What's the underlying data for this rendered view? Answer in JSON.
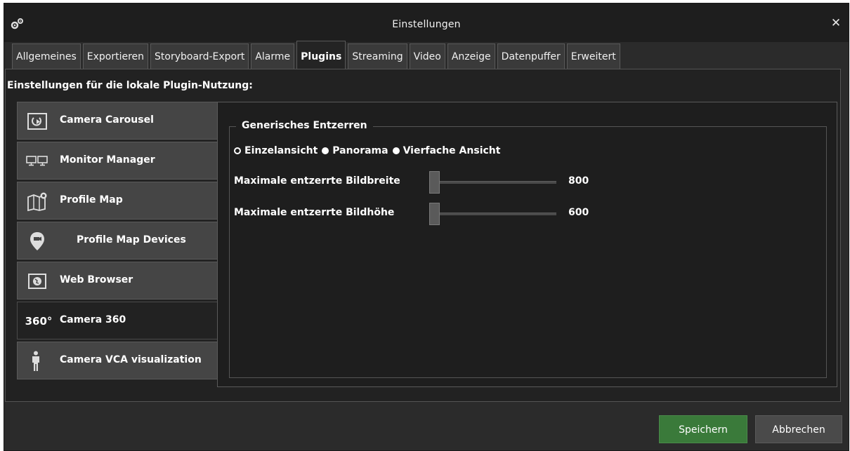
{
  "window": {
    "title": "Einstellungen",
    "close_glyph": "✕"
  },
  "tabs": [
    {
      "label": "Allgemeines",
      "active": false
    },
    {
      "label": "Exportieren",
      "active": false
    },
    {
      "label": "Storyboard-Export",
      "active": false
    },
    {
      "label": "Alarme",
      "active": false
    },
    {
      "label": "Plugins",
      "active": true
    },
    {
      "label": "Streaming",
      "active": false
    },
    {
      "label": "Video",
      "active": false
    },
    {
      "label": "Anzeige",
      "active": false
    },
    {
      "label": "Datenpuffer",
      "active": false
    },
    {
      "label": "Erweitert",
      "active": false
    }
  ],
  "plugins_section": {
    "header": "Einstellungen für die lokale Plugin-Nutzung:",
    "items": [
      {
        "label": "Camera Carousel",
        "icon": "camera-carousel-icon",
        "active": false
      },
      {
        "label": "Monitor Manager",
        "icon": "monitor-manager-icon",
        "active": false
      },
      {
        "label": "Profile Map",
        "icon": "profile-map-icon",
        "active": false
      },
      {
        "label": "Profile Map Devices",
        "icon": "map-pin-icon",
        "active": false
      },
      {
        "label": "Web Browser",
        "icon": "web-browser-icon",
        "active": false
      },
      {
        "label": "Camera 360",
        "icon": "camera-360-icon",
        "icon_text": "360°",
        "active": true
      },
      {
        "label": "Camera VCA visualization",
        "icon": "person-icon",
        "active": false
      }
    ]
  },
  "dewarp": {
    "group_title": "Generisches Entzerren",
    "modes": [
      {
        "label": "Einzelansicht",
        "selected": false
      },
      {
        "label": "Panorama",
        "selected": false
      },
      {
        "label": "Vierfache Ansicht",
        "selected": false
      }
    ],
    "max_width": {
      "label": "Maximale entzerrte Bildbreite",
      "value": "800"
    },
    "max_height": {
      "label": "Maximale entzerrte Bildhöhe",
      "value": "600"
    }
  },
  "buttons": {
    "save": "Speichern",
    "cancel": "Abbrechen"
  },
  "colors": {
    "save_button": "#3a7a3a",
    "background": "#2b2b2b"
  }
}
